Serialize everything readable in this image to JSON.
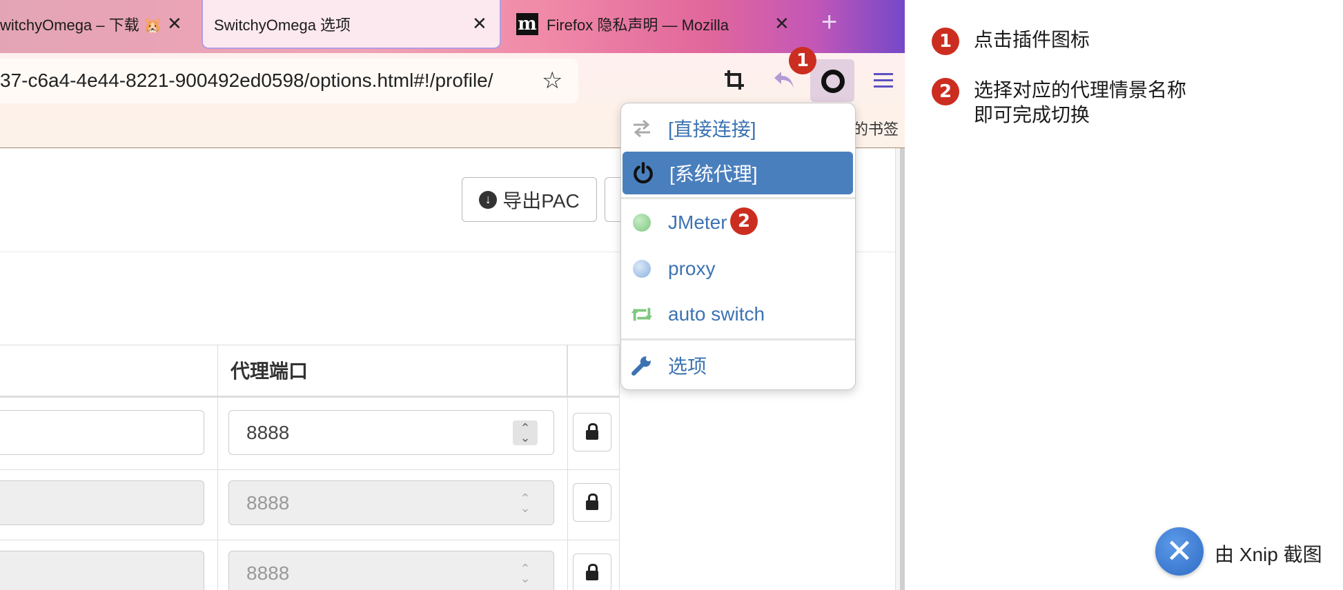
{
  "tabs": [
    {
      "title": "witchyOmega – 下载 🐹",
      "close": "✕"
    },
    {
      "title": "SwitchyOmega 选项",
      "close": "✕"
    },
    {
      "title": "Firefox 隐私声明 — Mozilla",
      "close": "✕",
      "logo": "m"
    }
  ],
  "new_tab": "+",
  "url": "37-c6a4-4e44-8221-900492ed0598/options.html#!/profile/",
  "star_icon": "☆",
  "bookmarks_text": "的书签",
  "export_button": "导出PAC",
  "table": {
    "port_header": "代理端口",
    "rows": [
      {
        "port": "8888",
        "disabled": false
      },
      {
        "port": "8888",
        "disabled": true
      },
      {
        "port": "8888",
        "disabled": true
      }
    ]
  },
  "popup": {
    "items": [
      {
        "label": "[直接连接]",
        "icon": "direct-arrows-icon"
      },
      {
        "label": "[系统代理]",
        "icon": "power-icon",
        "selected": true
      },
      {
        "label": "JMeter",
        "icon": "globe-icon",
        "color": "#7ec77e"
      },
      {
        "label": "proxy",
        "icon": "globe-icon",
        "color": "#8ab2e0"
      },
      {
        "label": "auto switch",
        "icon": "retweet-icon",
        "color": "#7ec77e"
      },
      {
        "label": "选项",
        "icon": "wrench-icon"
      }
    ]
  },
  "steps": [
    {
      "number": "1",
      "text": "点击插件图标"
    },
    {
      "number": "2",
      "text": "选择对应的代理情景名称",
      "text2": "即可完成切换"
    }
  ],
  "badge_color": "#cb2e20",
  "selected_color": "#4a7fbd",
  "link_color": "#3c73b2",
  "xnip": {
    "logo": "✕",
    "text": "由 Xnip 截图"
  }
}
